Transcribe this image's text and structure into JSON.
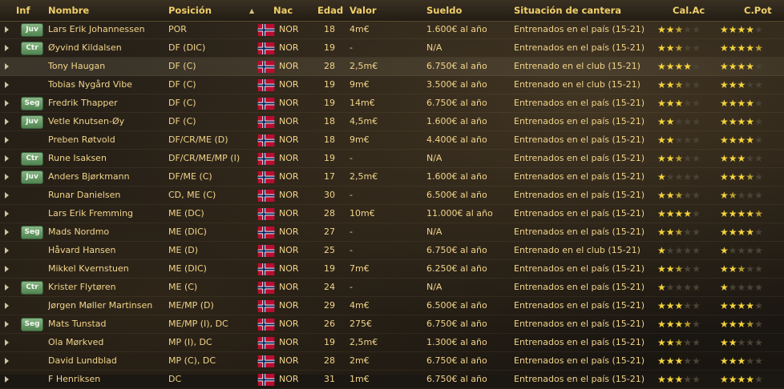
{
  "header": {
    "inf": "Inf",
    "nombre": "Nombre",
    "posicion": "Posición",
    "nac": "Nac",
    "edad": "Edad",
    "valor": "Valor",
    "sueldo": "Sueldo",
    "situacion": "Situación de cantera",
    "cal_ac": "Cal.Ac",
    "c_pot": "C.Pot"
  },
  "sort_icon": "sort-up-icon",
  "colors": {
    "text": "#f2d48a",
    "badge": "#5f9a60",
    "star": "#f4d43c"
  },
  "players": [
    {
      "badge": "Juv",
      "nombre": "Lars Erik Johannessen",
      "posicion": "POR",
      "nac": "NOR",
      "edad": "18",
      "valor": "4m€",
      "sueldo": "1.600€ al año",
      "situacion": "Entrenados en el país (15-21)",
      "cal_ac": 2.5,
      "c_pot": 4.0,
      "highlight": false
    },
    {
      "badge": "Ctr",
      "nombre": "Øyvind Kildalsen",
      "posicion": "DF (DIC)",
      "nac": "NOR",
      "edad": "19",
      "valor": "-",
      "sueldo": "N/A",
      "situacion": "Entrenados en el país (15-21)",
      "cal_ac": 2.5,
      "c_pot": 4.5,
      "highlight": false
    },
    {
      "badge": "",
      "nombre": "Tony Haugan",
      "posicion": "DF (C)",
      "nac": "NOR",
      "edad": "28",
      "valor": "2,5m€",
      "sueldo": "6.750€ al año",
      "situacion": "Entrenado en el club (15-21)",
      "cal_ac": 4.0,
      "c_pot": 4.0,
      "highlight": true
    },
    {
      "badge": "",
      "nombre": "Tobias Nygård Vibe",
      "posicion": "DF (C)",
      "nac": "NOR",
      "edad": "19",
      "valor": "9m€",
      "sueldo": "3.500€ al año",
      "situacion": "Entrenado en el club (15-21)",
      "cal_ac": 2.5,
      "c_pot": 3.0,
      "highlight": false
    },
    {
      "badge": "Seg",
      "nombre": "Fredrik Thapper",
      "posicion": "DF (C)",
      "nac": "NOR",
      "edad": "19",
      "valor": "14m€",
      "sueldo": "6.750€ al año",
      "situacion": "Entrenados en el país (15-21)",
      "cal_ac": 3.0,
      "c_pot": 4.0,
      "highlight": false
    },
    {
      "badge": "Juv",
      "nombre": "Vetle Knutsen-Øy",
      "posicion": "DF (C)",
      "nac": "NOR",
      "edad": "18",
      "valor": "4,5m€",
      "sueldo": "1.600€ al año",
      "situacion": "Entrenados en el país (15-21)",
      "cal_ac": 2.0,
      "c_pot": 4.0,
      "highlight": false
    },
    {
      "badge": "",
      "nombre": "Preben Røtvold",
      "posicion": "DF/CR/ME (D)",
      "nac": "NOR",
      "edad": "18",
      "valor": "9m€",
      "sueldo": "4.400€ al año",
      "situacion": "Entrenados en el país (15-21)",
      "cal_ac": 2.0,
      "c_pot": 4.0,
      "highlight": false
    },
    {
      "badge": "Ctr",
      "nombre": "Rune Isaksen",
      "posicion": "DF/CR/ME/MP (I)",
      "nac": "NOR",
      "edad": "19",
      "valor": "-",
      "sueldo": "N/A",
      "situacion": "Entrenados en el país (15-21)",
      "cal_ac": 2.5,
      "c_pot": 3.0,
      "highlight": false
    },
    {
      "badge": "Juv",
      "nombre": "Anders Bjørkmann",
      "posicion": "DF/ME (C)",
      "nac": "NOR",
      "edad": "17",
      "valor": "2,5m€",
      "sueldo": "1.600€ al año",
      "situacion": "Entrenados en el país (15-21)",
      "cal_ac": 1.0,
      "c_pot": 3.5,
      "highlight": false
    },
    {
      "badge": "",
      "nombre": "Runar Danielsen",
      "posicion": "CD, ME (C)",
      "nac": "NOR",
      "edad": "30",
      "valor": "-",
      "sueldo": "6.500€ al año",
      "situacion": "Entrenados en el país (15-21)",
      "cal_ac": 2.5,
      "c_pot": 1.5,
      "highlight": false
    },
    {
      "badge": "",
      "nombre": "Lars Erik Fremming",
      "posicion": "ME (DC)",
      "nac": "NOR",
      "edad": "28",
      "valor": "10m€",
      "sueldo": "11.000€ al año",
      "situacion": "Entrenados en el país (15-21)",
      "cal_ac": 4.0,
      "c_pot": 4.5,
      "highlight": false
    },
    {
      "badge": "Seg",
      "nombre": "Mads Nordmo",
      "posicion": "ME (DIC)",
      "nac": "NOR",
      "edad": "27",
      "valor": "-",
      "sueldo": "N/A",
      "situacion": "Entrenados en el país (15-21)",
      "cal_ac": 2.5,
      "c_pot": 4.0,
      "highlight": false
    },
    {
      "badge": "",
      "nombre": "Håvard Hansen",
      "posicion": "ME (D)",
      "nac": "NOR",
      "edad": "25",
      "valor": "-",
      "sueldo": "6.750€ al año",
      "situacion": "Entrenado en el club (15-21)",
      "cal_ac": 1.0,
      "c_pot": 1.0,
      "highlight": false
    },
    {
      "badge": "",
      "nombre": "Mikkel Kvernstuen",
      "posicion": "ME (DIC)",
      "nac": "NOR",
      "edad": "19",
      "valor": "7m€",
      "sueldo": "6.250€ al año",
      "situacion": "Entrenados en el país (15-21)",
      "cal_ac": 2.5,
      "c_pot": 2.5,
      "highlight": false
    },
    {
      "badge": "Ctr",
      "nombre": "Krister Flytøren",
      "posicion": "ME (C)",
      "nac": "NOR",
      "edad": "24",
      "valor": "-",
      "sueldo": "N/A",
      "situacion": "Entrenados en el país (15-21)",
      "cal_ac": 1.0,
      "c_pot": 1.0,
      "highlight": false
    },
    {
      "badge": "",
      "nombre": "Jørgen Møller Martinsen",
      "posicion": "ME/MP (D)",
      "nac": "NOR",
      "edad": "29",
      "valor": "4m€",
      "sueldo": "6.500€ al año",
      "situacion": "Entrenados en el país (15-21)",
      "cal_ac": 3.0,
      "c_pot": 4.0,
      "highlight": false
    },
    {
      "badge": "Seg",
      "nombre": "Mats Tunstad",
      "posicion": "ME/MP (I), DC",
      "nac": "NOR",
      "edad": "26",
      "valor": "275€",
      "sueldo": "6.750€ al año",
      "situacion": "Entrenados en el país (15-21)",
      "cal_ac": 3.5,
      "c_pot": 3.5,
      "highlight": false
    },
    {
      "badge": "",
      "nombre": "Ola Mørkved",
      "posicion": "MP (I), DC",
      "nac": "NOR",
      "edad": "19",
      "valor": "2,5m€",
      "sueldo": "1.300€ al año",
      "situacion": "Entrenados en el país (15-21)",
      "cal_ac": 2.5,
      "c_pot": 2.0,
      "highlight": false
    },
    {
      "badge": "",
      "nombre": "David Lundblad",
      "posicion": "MP (C), DC",
      "nac": "NOR",
      "edad": "28",
      "valor": "2m€",
      "sueldo": "6.750€ al año",
      "situacion": "Entrenados en el país (15-21)",
      "cal_ac": 3.0,
      "c_pot": 3.0,
      "highlight": false
    },
    {
      "badge": "",
      "nombre": "F Henriksen",
      "posicion": "DC",
      "nac": "NOR",
      "edad": "31",
      "valor": "1m€",
      "sueldo": "6.750€ al año",
      "situacion": "Entrenados en el país (15-21)",
      "cal_ac": 3.0,
      "c_pot": 4.0,
      "highlight": false
    }
  ]
}
